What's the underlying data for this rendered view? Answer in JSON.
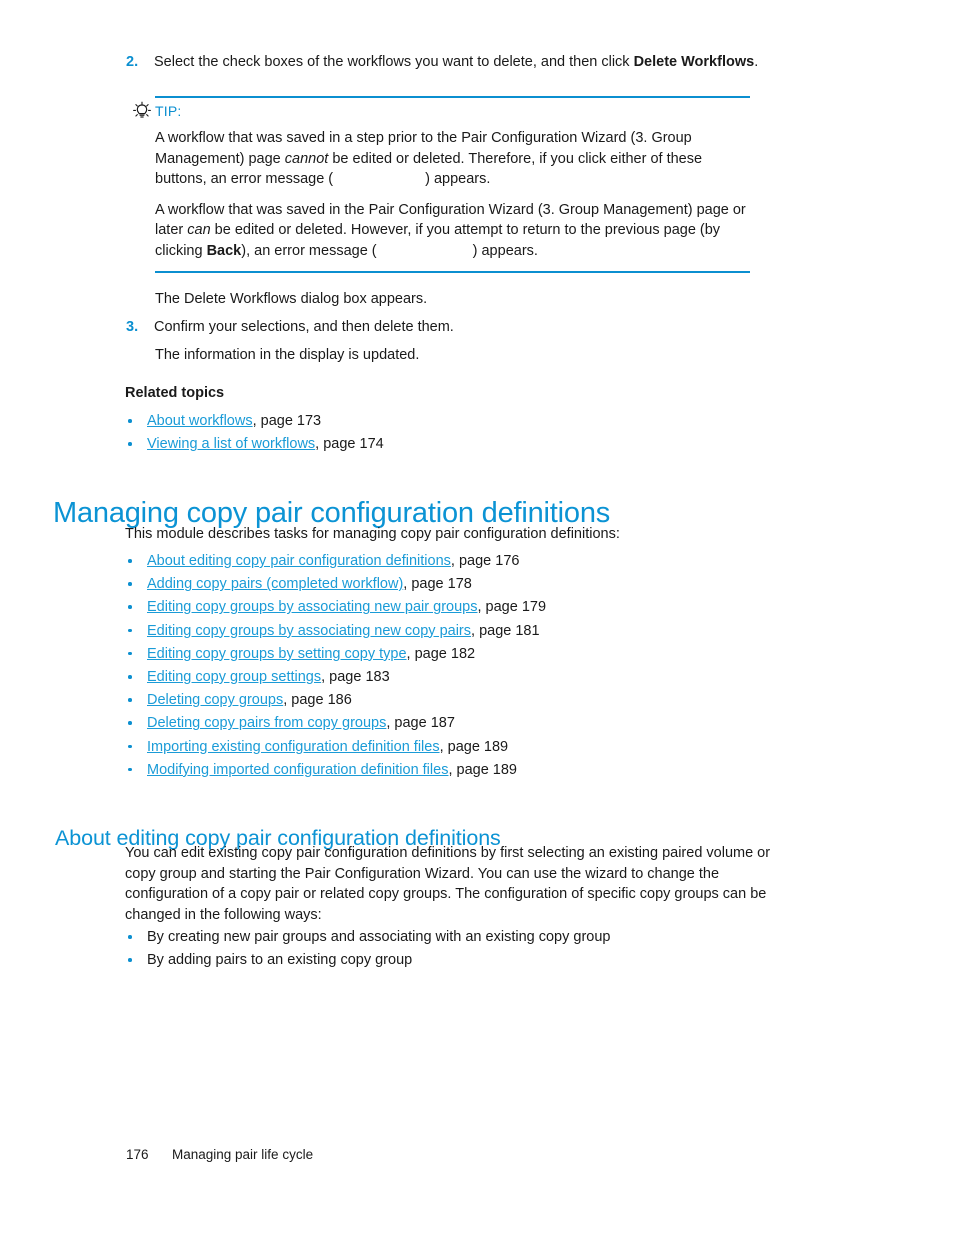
{
  "colors": {
    "heading_blue": "#0b93d4",
    "link_blue": "#1a9bd7",
    "accent_blue": "#0b8fd0",
    "body_text": "#1a1a1a"
  },
  "steps": [
    {
      "number": "2.",
      "text_before": "Select the check boxes of the workflows you want to delete, and then click ",
      "bold": "Delete Workflows",
      "text_after": "."
    },
    {
      "number": "3.",
      "text": "Confirm your selections, and then delete them."
    }
  ],
  "tip": {
    "icon": "lightbulb-icon",
    "label": "TIP:",
    "paragraphs": [
      {
        "seg1": "A workflow that was saved in a step prior to the Pair Configuration Wizard (3. Group Management) page ",
        "italic": "cannot",
        "seg2": " be edited or deleted. Therefore, if you click either of these buttons, an error message (",
        "seg3": ") appears."
      },
      {
        "seg1": "A workflow that was saved in the Pair Configuration Wizard (3. Group Management) page or later ",
        "italic": "can",
        "seg2": " be edited or deleted. However, if you attempt to return to the previous page (by clicking ",
        "bold": "Back",
        "seg3": "), an error message (",
        "seg4": ") appears."
      }
    ]
  },
  "result_lines": {
    "after_step2": "The Delete Workflows dialog box appears.",
    "after_step3": "The information in the display is updated."
  },
  "related_topics": {
    "heading": "Related topics",
    "items": [
      {
        "link": "About workflows",
        "rest": ", page 173"
      },
      {
        "link": "Viewing a list of workflows",
        "rest": ", page 174"
      }
    ]
  },
  "section_main": {
    "heading": "Managing copy pair configuration definitions",
    "intro": "This module describes tasks for managing copy pair configuration definitions:",
    "items": [
      {
        "link": "About editing copy pair configuration definitions",
        "rest": ", page 176"
      },
      {
        "link": "Adding copy pairs (completed workflow)",
        "rest": ", page 178"
      },
      {
        "link": "Editing copy groups by associating new pair groups",
        "rest": ", page 179"
      },
      {
        "link": "Editing copy groups by associating new copy pairs",
        "rest": ", page 181"
      },
      {
        "link": "Editing copy groups by setting copy type",
        "rest": ", page 182"
      },
      {
        "link": "Editing copy group settings",
        "rest": ", page 183"
      },
      {
        "link": "Deleting copy groups",
        "rest": ", page 186"
      },
      {
        "link": "Deleting copy pairs from copy groups",
        "rest": ", page 187"
      },
      {
        "link": "Importing existing configuration definition files",
        "rest": ", page 189"
      },
      {
        "link": "Modifying imported configuration definition files",
        "rest": ", page 189"
      }
    ]
  },
  "section_about": {
    "heading": "About editing copy pair configuration definitions",
    "body": "You can edit existing copy pair configuration definitions by first selecting an existing paired volume or copy group and starting the Pair Configuration Wizard. You can use the wizard to change the configuration of a copy pair or related copy groups. The configuration of specific copy groups can be changed in the following ways:",
    "items": [
      "By creating new pair groups and associating with an existing copy group",
      "By adding pairs to an existing copy group"
    ]
  },
  "footer": {
    "page_number": "176",
    "chapter": "Managing pair life cycle"
  }
}
